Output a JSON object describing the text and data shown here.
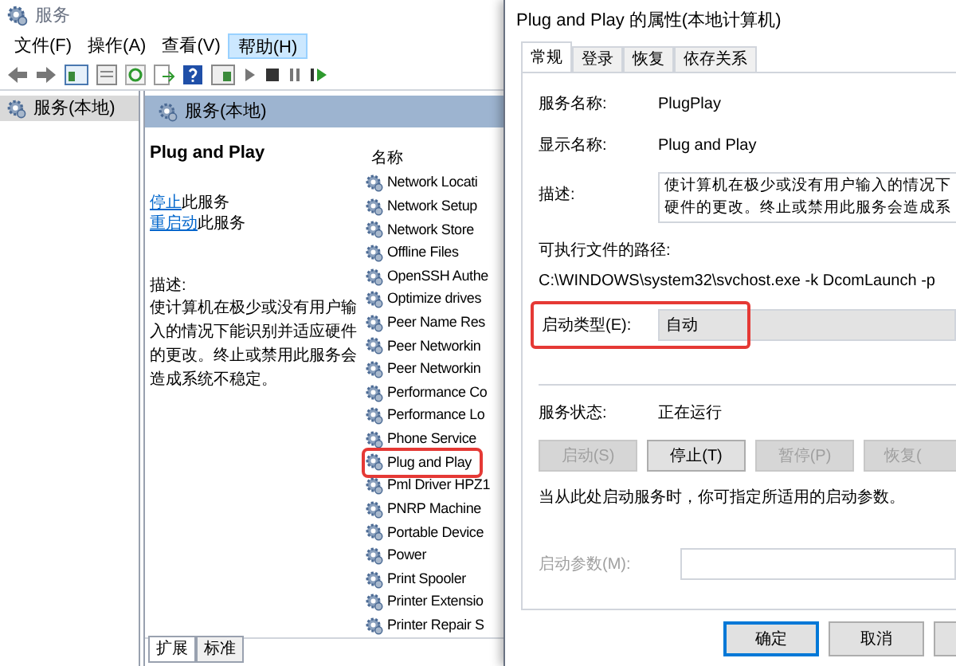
{
  "services_window": {
    "title": "服务",
    "menu": [
      {
        "label": "文件(F)",
        "selected": false
      },
      {
        "label": "操作(A)",
        "selected": false
      },
      {
        "label": "查看(V)",
        "selected": false
      },
      {
        "label": "帮助(H)",
        "selected": true
      }
    ],
    "tree": [
      {
        "label": "服务(本地)",
        "selected": true
      }
    ],
    "header": "服务(本地)",
    "detail": {
      "title": "Plug and Play",
      "links": [
        {
          "link": "停止",
          "rest": "此服务"
        },
        {
          "link": "重启动",
          "rest": "此服务"
        }
      ],
      "description_label": "描述:",
      "description": "使计算机在极少或没有用户输入的情况下能识别并适应硬件的更改。终止或禁用此服务会造成系统不稳定。"
    },
    "list": {
      "column": "名称",
      "rows": [
        {
          "name": "Network Locati",
          "highlighted": false
        },
        {
          "name": "Network Setup",
          "highlighted": false
        },
        {
          "name": "Network Store",
          "highlighted": false
        },
        {
          "name": "Offline Files",
          "highlighted": false
        },
        {
          "name": "OpenSSH Authe",
          "highlighted": false
        },
        {
          "name": "Optimize drives",
          "highlighted": false
        },
        {
          "name": "Peer Name Res",
          "highlighted": false
        },
        {
          "name": "Peer Networkin",
          "highlighted": false
        },
        {
          "name": "Peer Networkin",
          "highlighted": false
        },
        {
          "name": "Performance Co",
          "highlighted": false
        },
        {
          "name": "Performance Lo",
          "highlighted": false
        },
        {
          "name": "Phone Service",
          "highlighted": false
        },
        {
          "name": "Plug and Play",
          "highlighted": true
        },
        {
          "name": "Pml Driver HPZ1",
          "highlighted": false
        },
        {
          "name": "PNRP Machine",
          "highlighted": false
        },
        {
          "name": "Portable Device",
          "highlighted": false
        },
        {
          "name": "Power",
          "highlighted": false
        },
        {
          "name": "Print Spooler",
          "highlighted": false
        },
        {
          "name": "Printer Extensio",
          "highlighted": false
        },
        {
          "name": "Printer Repair S",
          "highlighted": false
        }
      ]
    },
    "bottom_tabs": [
      {
        "label": "扩展",
        "selected": true
      },
      {
        "label": "标准",
        "selected": false
      }
    ]
  },
  "dialog": {
    "title": "Plug and Play 的属性(本地计算机)",
    "tabs": [
      {
        "label": "常规",
        "selected": true
      },
      {
        "label": "登录",
        "selected": false
      },
      {
        "label": "恢复",
        "selected": false
      },
      {
        "label": "依存关系",
        "selected": false
      }
    ],
    "service_name": {
      "label": "服务名称:",
      "value": "PlugPlay"
    },
    "display_name": {
      "label": "显示名称:",
      "value": "Plug and Play"
    },
    "description": {
      "label": "描述:",
      "lines": [
        "使计算机在极少或没有用户输入的情况下",
        "硬件的更改。终止或禁用此服务会造成系"
      ]
    },
    "path": {
      "label": "可执行文件的路径:",
      "value": "C:\\WINDOWS\\system32\\svchost.exe -k DcomLaunch -p"
    },
    "startup_type": {
      "label": "启动类型(E):",
      "value": "自动",
      "highlighted": true
    },
    "status": {
      "label": "服务状态:",
      "value": "正在运行"
    },
    "service_buttons": [
      {
        "label": "启动(S)",
        "disabled": true
      },
      {
        "label": "停止(T)",
        "disabled": false
      },
      {
        "label": "暂停(P)",
        "disabled": true
      },
      {
        "label": "恢复(",
        "disabled": true
      }
    ],
    "hint": "当从此处启动服务时，你可指定所适用的启动参数。",
    "start_params": {
      "label": "启动参数(M):",
      "disabled": true
    },
    "footer_buttons": [
      {
        "label": "确定",
        "default": true
      },
      {
        "label": "取消",
        "default": false
      },
      {
        "default": false
      }
    ]
  }
}
